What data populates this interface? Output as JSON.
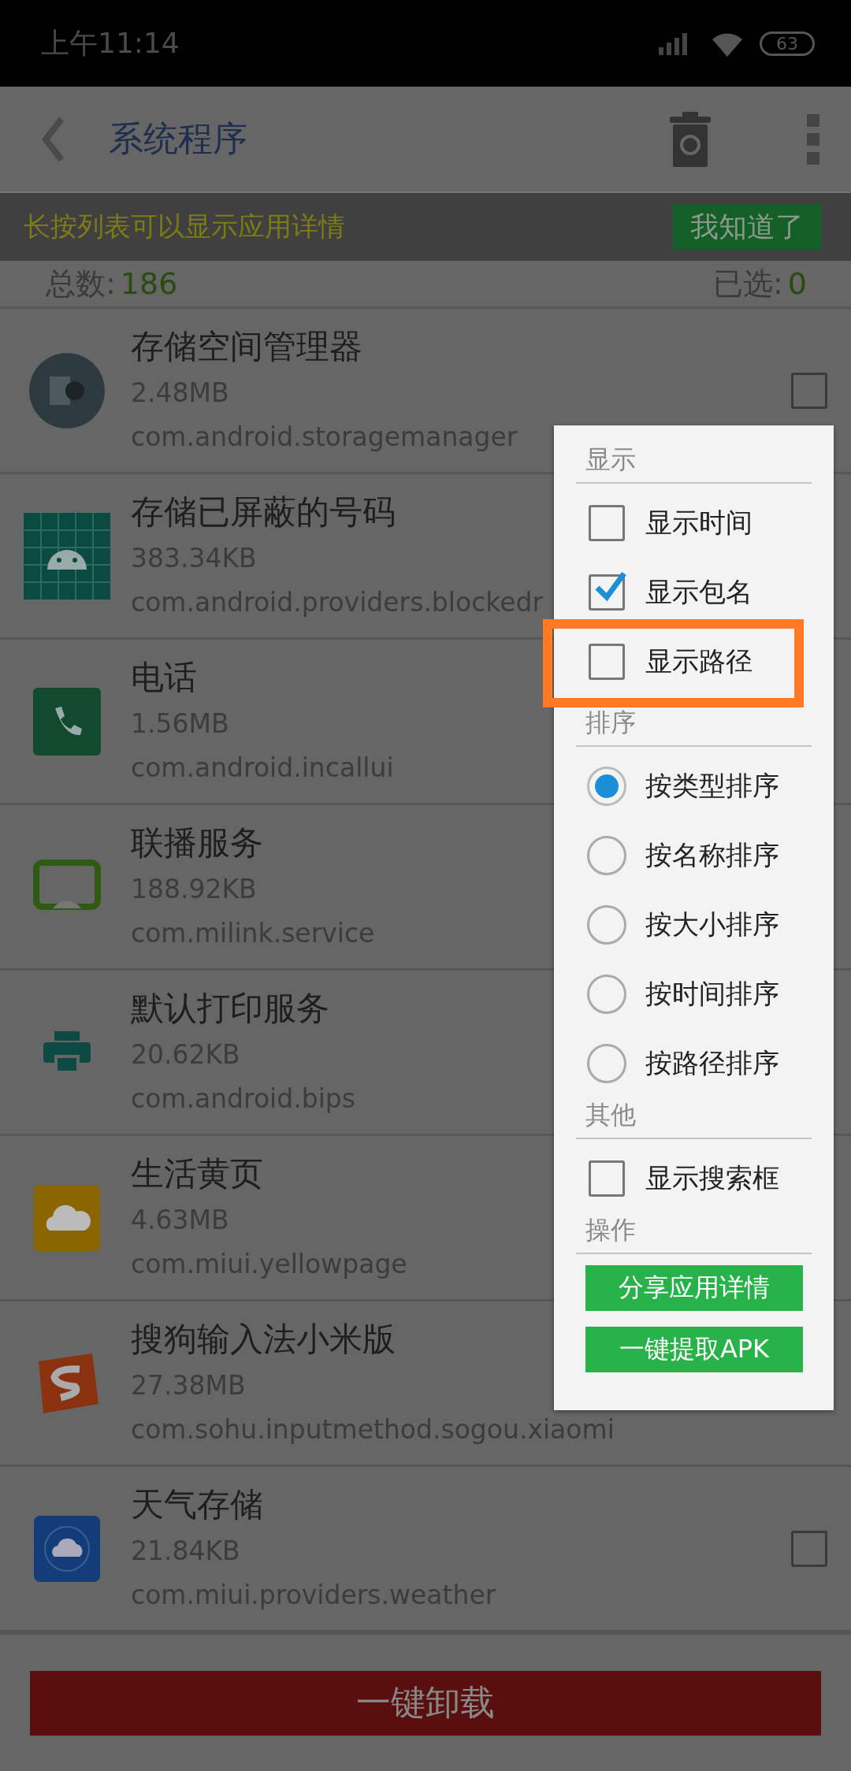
{
  "status_bar": {
    "time": "上午11:14",
    "battery": "63"
  },
  "toolbar": {
    "title": "系统程序"
  },
  "tip": {
    "text": "长按列表可以显示应用详情",
    "button": "我知道了"
  },
  "summary": {
    "total_label": "总数:",
    "total": "186",
    "selected_label": "已选:",
    "selected": "0"
  },
  "apps": [
    {
      "name": "存储空间管理器",
      "size": "2.48MB",
      "package": "com.android.storagemanager",
      "checked": false
    },
    {
      "name": "存储已屏蔽的号码",
      "size": "383.34KB",
      "package": "com.android.providers.blockedr"
    },
    {
      "name": "电话",
      "size": "1.56MB",
      "package": "com.android.incallui"
    },
    {
      "name": "联播服务",
      "size": "188.92KB",
      "package": "com.milink.service"
    },
    {
      "name": "默认打印服务",
      "size": "20.62KB",
      "package": "com.android.bips"
    },
    {
      "name": "生活黄页",
      "size": "4.63MB",
      "package": "com.miui.yellowpage"
    },
    {
      "name": "搜狗输入法小米版",
      "size": "27.38MB",
      "package": "com.sohu.inputmethod.sogou.xiaomi"
    },
    {
      "name": "天气存储",
      "size": "21.84KB",
      "package": "com.miui.providers.weather",
      "checked": false
    }
  ],
  "menu": [
    {
      "title": "显示",
      "items": [
        {
          "kind": "checkbox",
          "label": "显示时间",
          "checked": false
        },
        {
          "kind": "checkbox",
          "label": "显示包名",
          "checked": true
        },
        {
          "kind": "checkbox",
          "label": "显示路径",
          "checked": false,
          "highlighted": true
        }
      ]
    },
    {
      "title": "排序",
      "items": [
        {
          "kind": "radio",
          "label": "按类型排序",
          "selected": true
        },
        {
          "kind": "radio",
          "label": "按名称排序",
          "selected": false
        },
        {
          "kind": "radio",
          "label": "按大小排序",
          "selected": false
        },
        {
          "kind": "radio",
          "label": "按时间排序",
          "selected": false
        },
        {
          "kind": "radio",
          "label": "按路径排序",
          "selected": false
        }
      ]
    },
    {
      "title": "其他",
      "items": [
        {
          "kind": "checkbox",
          "label": "显示搜索框",
          "checked": false
        }
      ]
    },
    {
      "title": "操作",
      "items": [
        {
          "kind": "button",
          "label": "分享应用详情"
        },
        {
          "kind": "button",
          "label": "一键提取APK"
        }
      ]
    }
  ],
  "bottom_button": "一键卸载"
}
